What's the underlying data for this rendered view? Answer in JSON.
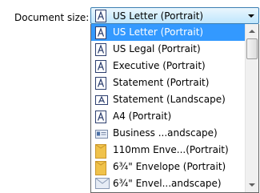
{
  "document_size": {
    "label": "Document size:",
    "selected": {
      "label": "US Letter (Portrait)",
      "icon": "page-portrait-icon"
    },
    "options": [
      {
        "label": "US Letter (Portrait)",
        "icon": "page-portrait-icon",
        "selected": true
      },
      {
        "label": "US Legal (Portrait)",
        "icon": "page-portrait-icon",
        "selected": false
      },
      {
        "label": "Executive (Portrait)",
        "icon": "page-portrait-icon",
        "selected": false
      },
      {
        "label": "Statement (Portrait)",
        "icon": "page-portrait-icon",
        "selected": false
      },
      {
        "label": "Statement (Landscape)",
        "icon": "page-landscape-icon",
        "selected": false
      },
      {
        "label": "A4 (Portrait)",
        "icon": "page-portrait-icon",
        "selected": false
      },
      {
        "label": "Business ...andscape)",
        "icon": "business-card-icon",
        "selected": false
      },
      {
        "label": "110mm Enve...(Portrait)",
        "icon": "envelope-portrait-icon",
        "selected": false
      },
      {
        "label": "6¾\" Envelope (Portrait)",
        "icon": "envelope-portrait-icon",
        "selected": false
      },
      {
        "label": "6¾\" Envel...andscape)",
        "icon": "envelope-landscape-icon",
        "selected": false
      }
    ]
  },
  "colors": {
    "selection": "#3399ff",
    "combo_border": "#3c7fb1"
  }
}
